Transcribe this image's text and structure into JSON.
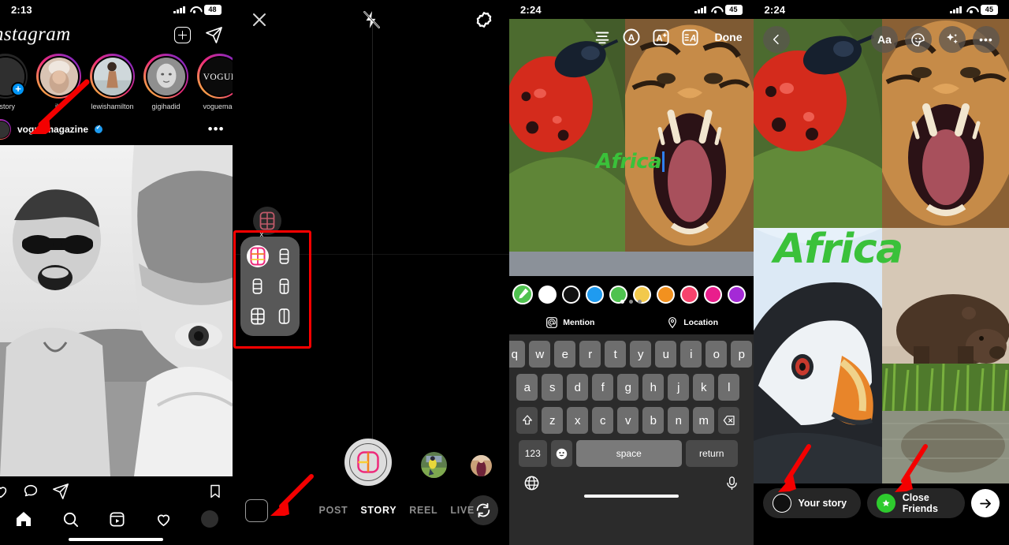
{
  "panels": [
    {
      "id": "instagram-feed",
      "status": {
        "time": "2:13",
        "battery": "48"
      },
      "header": {
        "logo": "nstagram",
        "add_icon": "plus-square-icon",
        "send_icon": "paper-plane-icon"
      },
      "stories": [
        {
          "name": "r story",
          "badge": "+",
          "type": "your-story"
        },
        {
          "name": "jlo"
        },
        {
          "name": "lewishamilton"
        },
        {
          "name": "gigihadid"
        },
        {
          "name": "voguemag",
          "label": "VOGUE"
        }
      ],
      "post": {
        "username": "voguemagazine",
        "verified": true,
        "more": "•••"
      },
      "actions": {
        "like": "heart-icon",
        "comment": "comment-icon",
        "share": "paper-plane-icon",
        "save": "bookmark-icon"
      },
      "tabbar": [
        "home-icon",
        "search-icon",
        "reels-icon",
        "heart-icon",
        "profile-avatar"
      ]
    },
    {
      "id": "camera-layout",
      "top": {
        "close": "close-icon",
        "flash": "flash-off-icon",
        "settings": "settings-icon"
      },
      "layout_chip": "layout-grid-icon",
      "layout_close": "x",
      "layout_options": [
        {
          "name": "grid-2x3",
          "selected": true
        },
        {
          "name": "stack-3-rows-narrow",
          "selected": false
        },
        {
          "name": "stack-3-rows",
          "selected": false
        },
        {
          "name": "one-top-two-bottom",
          "selected": false
        },
        {
          "name": "grid-3x2",
          "selected": false
        },
        {
          "name": "two-columns",
          "selected": false
        }
      ],
      "shutter": "layout-capture-icon",
      "gallery": "gallery-square-icon",
      "modes": [
        {
          "label": "POST",
          "active": false
        },
        {
          "label": "STORY",
          "active": true
        },
        {
          "label": "REEL",
          "active": false
        },
        {
          "label": "LIVE",
          "active": false
        }
      ],
      "flip": "flip-camera-icon"
    },
    {
      "id": "text-editor",
      "status": {
        "time": "2:24",
        "battery": "45"
      },
      "toolbar": [
        {
          "name": "text-align-icon"
        },
        {
          "name": "circled-a-icon"
        },
        {
          "name": "text-effect-icon"
        },
        {
          "name": "text-style-icon"
        }
      ],
      "done_label": "Done",
      "text_value": "Africa",
      "colors": [
        {
          "hex": "#4fc24f",
          "name": "eyedropper-green",
          "selected": true
        },
        {
          "hex": "#ffffff",
          "name": "white"
        },
        {
          "hex": "#111111",
          "name": "black"
        },
        {
          "hex": "#1f9bf0",
          "name": "blue"
        },
        {
          "hex": "#4fc24f",
          "name": "green"
        },
        {
          "hex": "#f2c94c",
          "name": "yellow"
        },
        {
          "hex": "#f2911f",
          "name": "orange"
        },
        {
          "hex": "#f6436c",
          "name": "red"
        },
        {
          "hex": "#e91e8c",
          "name": "magenta"
        },
        {
          "hex": "#a42ad6",
          "name": "purple"
        }
      ],
      "page_dots": 3,
      "page_dot_active": 0,
      "quick_actions": [
        {
          "label": "Mention",
          "icon": "at-icon"
        },
        {
          "label": "Location",
          "icon": "location-pin-icon"
        }
      ],
      "keyboard": {
        "row1": [
          "q",
          "w",
          "e",
          "r",
          "t",
          "y",
          "u",
          "i",
          "o",
          "p"
        ],
        "row2": [
          "a",
          "s",
          "d",
          "f",
          "g",
          "h",
          "j",
          "k",
          "l"
        ],
        "row3": [
          "z",
          "x",
          "c",
          "v",
          "b",
          "n",
          "m"
        ],
        "shift": "shift-icon",
        "backspace": "backspace-icon",
        "numbers": "123",
        "emoji": "emoji-icon",
        "space": "space",
        "return": "return",
        "globe": "globe-icon",
        "mic": "microphone-icon"
      }
    },
    {
      "id": "story-share",
      "status": {
        "time": "2:24",
        "battery": "45"
      },
      "back": "back-chevron-icon",
      "tools": [
        {
          "label": "Aa",
          "name": "text-tool"
        },
        {
          "label": "",
          "name": "sticker-icon"
        },
        {
          "label": "",
          "name": "sparkles-icon"
        },
        {
          "label": "•••",
          "name": "more-icon"
        }
      ],
      "overlay_text": "Africa",
      "share": [
        {
          "label": "Your story",
          "name": "your-story-button"
        },
        {
          "label": "Close Friends",
          "name": "close-friends-button"
        }
      ],
      "next": "arrow-right-icon"
    }
  ],
  "annotations": {
    "arrow_color": "#f40000",
    "arrows": [
      {
        "name": "arrow-to-your-story"
      },
      {
        "name": "arrow-to-gallery-square"
      },
      {
        "name": "arrow-to-your-story-pill"
      },
      {
        "name": "arrow-to-close-friends-pill"
      }
    ],
    "highlight_box_color": "#ff0000"
  }
}
